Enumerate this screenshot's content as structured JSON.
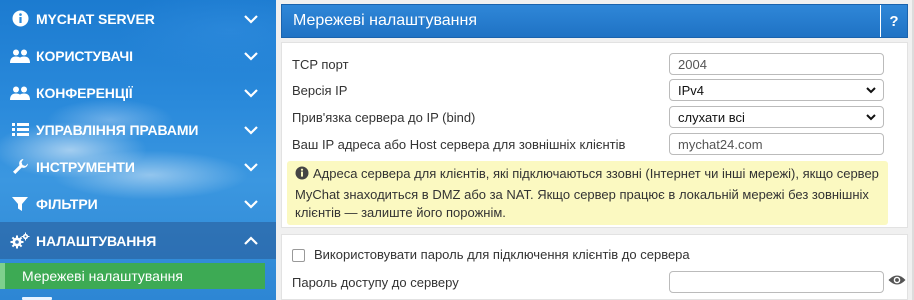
{
  "sidebar": {
    "items": [
      {
        "label": "MYCHAT SERVER",
        "icon": "info-icon",
        "expanded": false
      },
      {
        "label": "КОРИСТУВАЧІ",
        "icon": "users-icon",
        "expanded": false
      },
      {
        "label": "КОНФЕРЕНЦІЇ",
        "icon": "users-icon",
        "expanded": false
      },
      {
        "label": "УПРАВЛІННЯ ПРАВАМИ",
        "icon": "list-icon",
        "expanded": false
      },
      {
        "label": "ІНСТРУМЕНТИ",
        "icon": "wrench-icon",
        "expanded": false
      },
      {
        "label": "ФІЛЬТРИ",
        "icon": "filter-icon",
        "expanded": false
      },
      {
        "label": "НАЛАШТУВАННЯ",
        "icon": "gears-icon",
        "expanded": true
      }
    ],
    "active_subitem": "Мережеві налаштування"
  },
  "panel": {
    "title": "Мережеві налаштування",
    "help_label": "?"
  },
  "form": {
    "tcp_port_label": "TCP порт",
    "tcp_port_value": "2004",
    "ip_version_label": "Версія IP",
    "ip_version_value": "IPv4",
    "bind_label": "Прив'язка сервера до IP (bind)",
    "bind_value": "слухати всі",
    "host_label": "Ваш IP адреса або Host сервера для зовнішніх клієнтів",
    "host_value": "mychat24.com",
    "note_text": "Адреса сервера для клієнтів, які підключаються ззовні (Інтернет чи інші мережі), якщо сервер MyChat знаходиться в DMZ або за NAT. Якщо сервер працює в локальній мережі без зовнішніх клієнтів — залиште його порожнім."
  },
  "password_section": {
    "checkbox_label": "Використовувати пароль для підключення клієнтів до сервера",
    "checkbox_checked": false,
    "password_label": "Пароль доступу до серверу",
    "password_value": ""
  },
  "colors": {
    "sidebar_blue": "#2a8adb",
    "header_blue": "#2f87d8",
    "active_green": "#3daa54",
    "note_yellow": "#fbf9c1"
  }
}
